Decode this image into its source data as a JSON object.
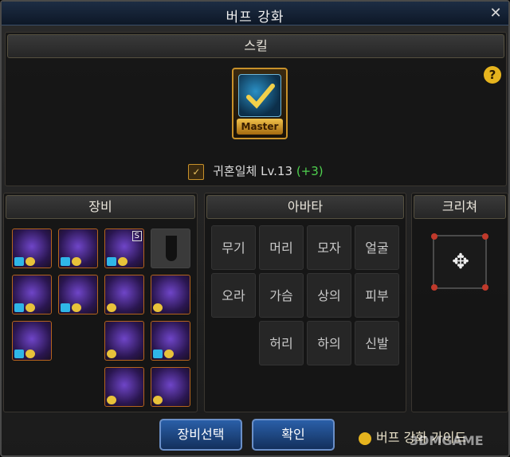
{
  "window": {
    "title": "버프 강화",
    "close_label": "✕"
  },
  "skill_section": {
    "header": "스킬",
    "skill_badge": "Master",
    "help_icon": "?",
    "skill_name": "귀혼일체 Lv.13",
    "skill_bonus": "(+3)"
  },
  "equipment_section": {
    "header": "장비",
    "special_tag": "S"
  },
  "avatar_section": {
    "header": "아바타",
    "slots": [
      "무기",
      "머리",
      "모자",
      "얼굴",
      "오라",
      "가슴",
      "상의",
      "피부",
      "허리",
      "하의",
      "신발"
    ]
  },
  "creature_section": {
    "header": "크리쳐"
  },
  "buttons": {
    "equip_select": "장비선택",
    "confirm": "확인",
    "guide": "버프 강화 가이드"
  },
  "watermark": "3DMGAME",
  "colors": {
    "accent_gold": "#c8912a",
    "bonus_green": "#4fd14f",
    "button_blue": "#2a5fa8"
  }
}
